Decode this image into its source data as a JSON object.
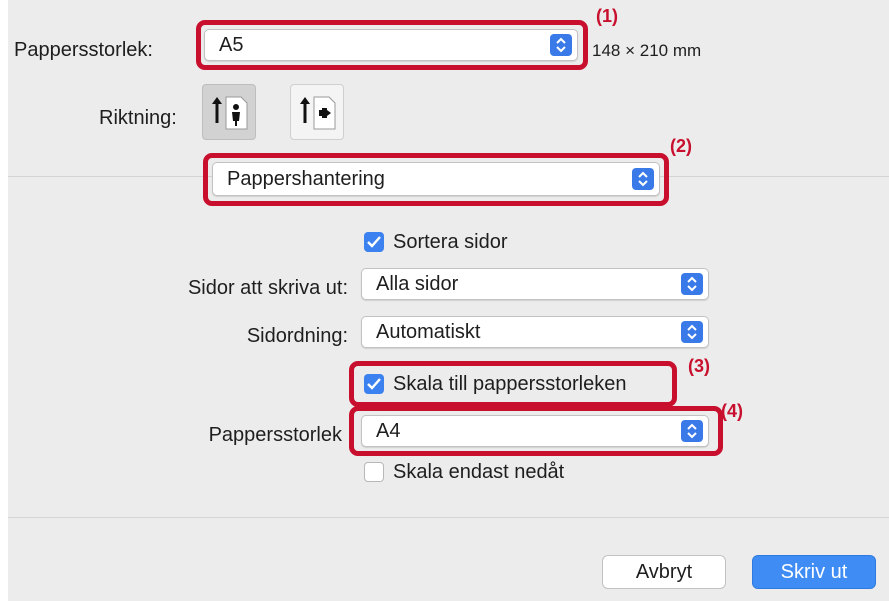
{
  "paper_size": {
    "label": "Pappersstorlek:",
    "value": "A5",
    "dimensions": "148 × 210 mm"
  },
  "orientation": {
    "label": "Riktning:",
    "selected": "portrait"
  },
  "section_menu": {
    "value": "Pappershantering"
  },
  "collate": {
    "label": "Sortera sidor",
    "checked": true
  },
  "pages_to_print": {
    "label": "Sidor att skriva ut:",
    "value": "Alla sidor"
  },
  "page_order": {
    "label": "Sidordning:",
    "value": "Automatiskt"
  },
  "scale_to_paper": {
    "label": "Skala till pappersstorleken",
    "checked": true
  },
  "dest_paper_size": {
    "label": "Pappersstorlek",
    "value": "A4"
  },
  "scale_down_only": {
    "label": "Skala endast nedåt",
    "checked": false
  },
  "buttons": {
    "cancel": "Avbryt",
    "print": "Skriv ut"
  },
  "callouts": {
    "c1": "(1)",
    "c2": "(2)",
    "c3": "(3)",
    "c4": "(4)"
  },
  "colors": {
    "highlight_red": "#c8102e",
    "accent_blue": "#3b82f0"
  }
}
